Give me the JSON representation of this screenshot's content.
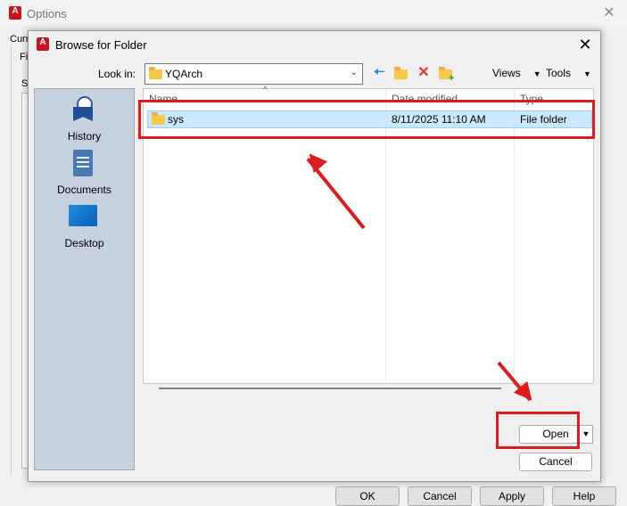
{
  "options_window": {
    "title": "Options",
    "partial_left_labels": [
      "Curr",
      "Fi",
      "S"
    ],
    "buttons": [
      "OK",
      "Cancel",
      "Apply",
      "Help"
    ]
  },
  "dialog": {
    "title": "Browse for Folder",
    "look_in_label": "Look in:",
    "look_in_value": "YQArch",
    "views_label": "Views",
    "tools_label": "Tools",
    "places": [
      {
        "label": "History",
        "icon": "history-icon"
      },
      {
        "label": "Documents",
        "icon": "documents-icon"
      },
      {
        "label": "Desktop",
        "icon": "desktop-icon"
      }
    ],
    "columns": [
      "Name",
      "Date modified",
      "Type"
    ],
    "rows": [
      {
        "name": "sys",
        "date": "8/11/2025 11:10 AM",
        "type": "File folder",
        "selected": true
      }
    ],
    "open_label": "Open",
    "cancel_label": "Cancel"
  },
  "colors": {
    "annotation_red": "#e01b1b",
    "selection": "#cce8ff",
    "places_panel": "#c5d1de"
  }
}
